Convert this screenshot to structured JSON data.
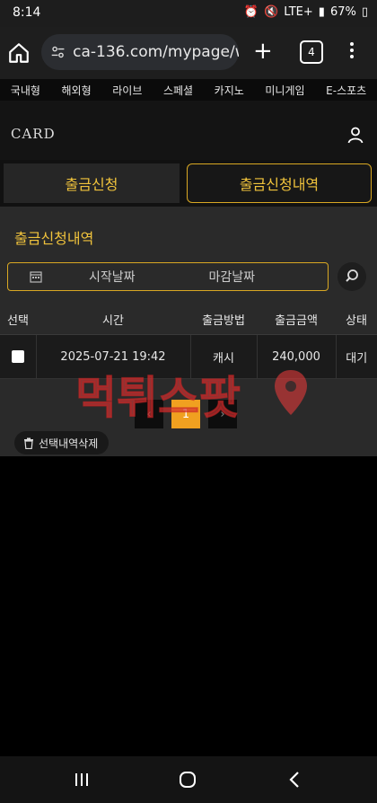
{
  "status_bar": {
    "time": "8:14",
    "network": "LTE+",
    "battery": "67%"
  },
  "browser": {
    "url": "ca-136.com/mypage/w",
    "tab_count": "4"
  },
  "site_menu": [
    "국내형",
    "해외형",
    "라이브",
    "스페셜",
    "카지노",
    "미니게임",
    "E-스포츠"
  ],
  "logo": {
    "text": "CARD"
  },
  "tabs": {
    "request": "출금신청",
    "history": "출금신청내역"
  },
  "history": {
    "title": "출금신청내역",
    "date_from_placeholder": "시작날짜",
    "date_to_placeholder": "마감날짜",
    "columns": [
      "선택",
      "시간",
      "출금방법",
      "출금금액",
      "상태"
    ],
    "rows": [
      {
        "time": "2025-07-21 19:42",
        "method": "캐시",
        "amount": "240,000",
        "status": "대기"
      }
    ],
    "pagination": {
      "prev": "‹",
      "current": "1",
      "next": "›"
    },
    "delete_label": "선택내역삭제"
  },
  "watermark": {
    "text": "먹튀스팟"
  },
  "colors": {
    "accent": "#f0c33c",
    "page_active": "#f0a020",
    "watermark_red": "#e23b3b"
  }
}
